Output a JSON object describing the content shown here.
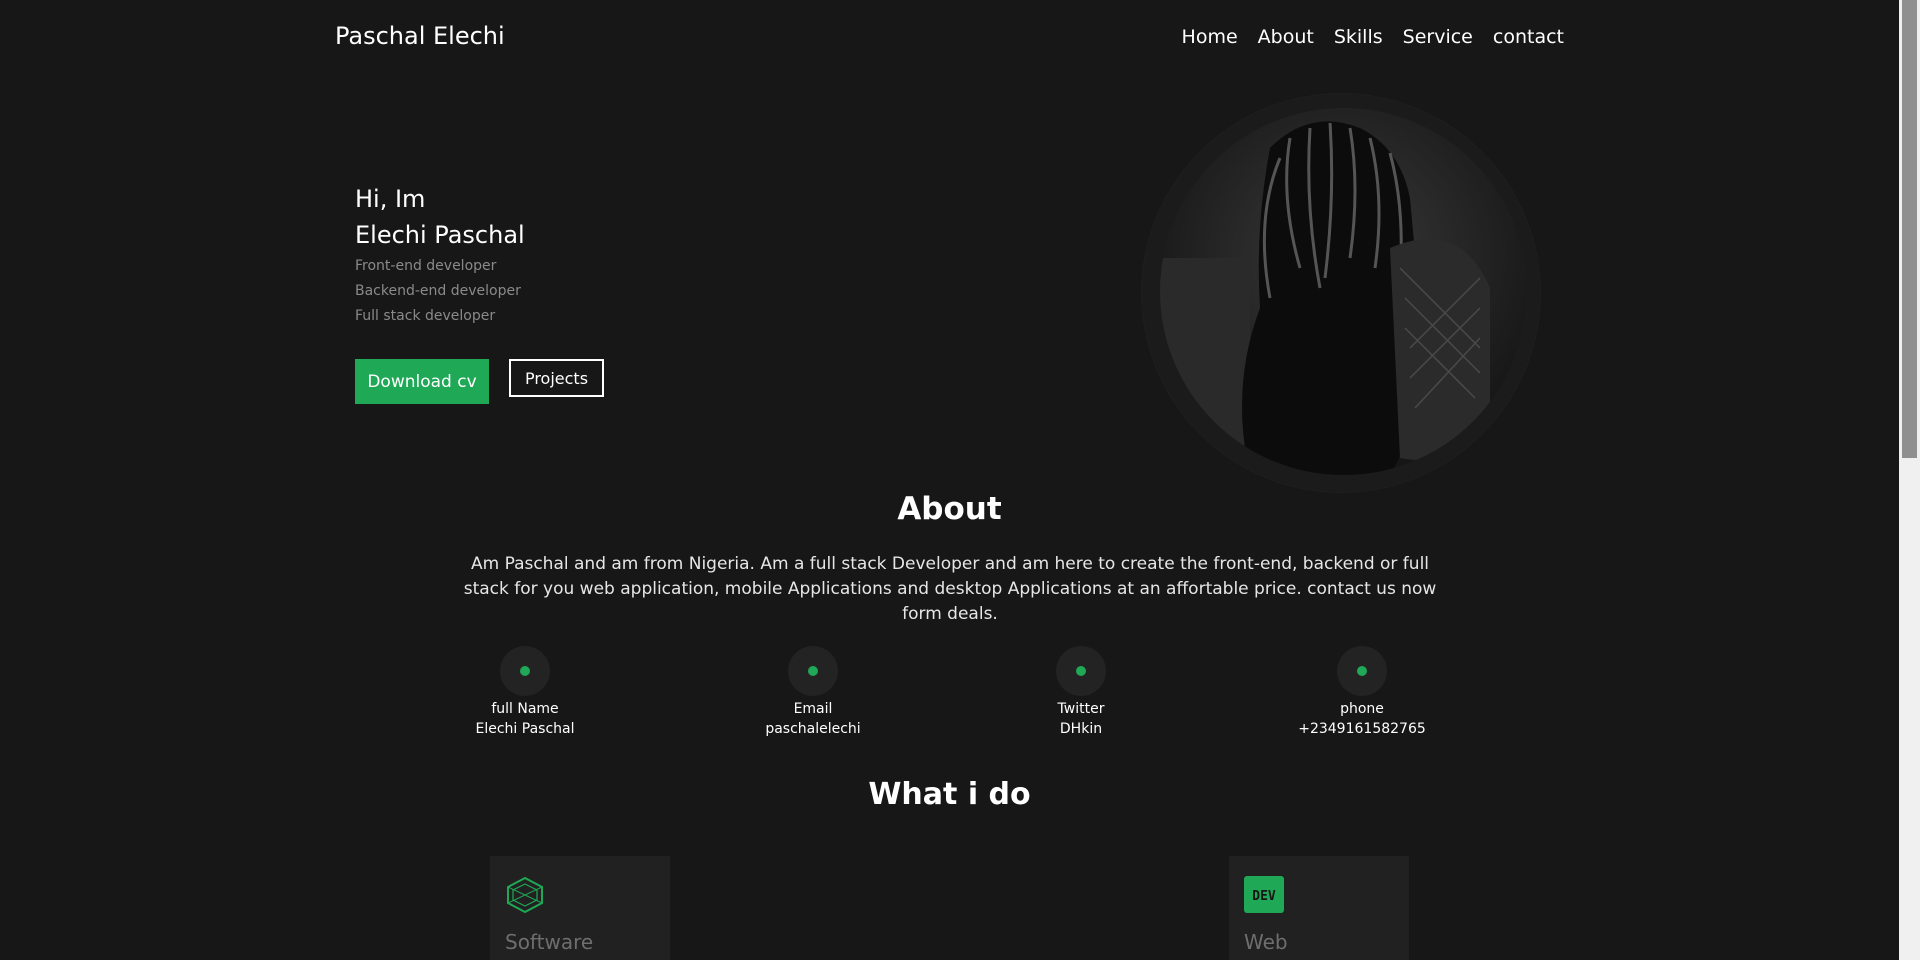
{
  "header": {
    "logo": "Paschal Elechi",
    "nav": [
      "Home",
      "About",
      "Skills",
      "Service",
      "contact"
    ]
  },
  "hero": {
    "greeting": "Hi, Im",
    "name": "Elechi Paschal",
    "roles": [
      "Front-end developer",
      "Backend-end developer",
      "Full stack developer"
    ],
    "download_label": "Download cv",
    "projects_label": "Projects"
  },
  "about": {
    "title": "About",
    "text": "Am Paschal and am from Nigeria. Am a full stack Developer and am here to create the front-end, backend or full stack for you web application, mobile Applications and desktop Applications at an affortable price. contact us now form deals.",
    "info": [
      {
        "label": "full Name",
        "value": "Elechi Paschal"
      },
      {
        "label": "Email",
        "value": "paschalelechi"
      },
      {
        "label": "Twitter",
        "value": "DHkin"
      },
      {
        "label": "phone",
        "value": "+2349161582765"
      }
    ]
  },
  "services": {
    "title": "What i do",
    "cards": [
      {
        "title": "Software",
        "icon": "hexagon-logo-icon"
      },
      {
        "title": "Web",
        "icon": "dev-logo-icon",
        "icon_text": "DEV"
      }
    ]
  },
  "colors": {
    "background": "#171717",
    "accent": "#1fa855",
    "muted": "#8a8a8a"
  }
}
